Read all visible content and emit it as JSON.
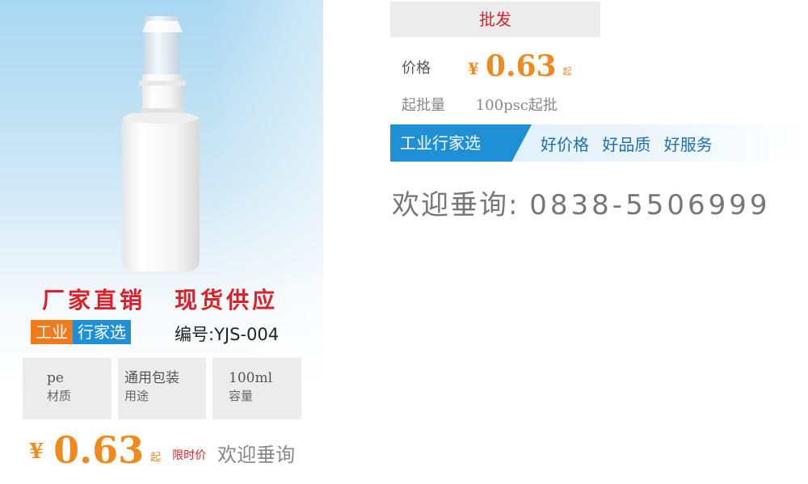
{
  "left": {
    "slogan_a": "厂家直销",
    "slogan_b": "现货供应",
    "brand_a": "工业",
    "brand_b": "行家选",
    "code": "编号:YJS-004",
    "specs": [
      {
        "value": "pe",
        "label": "材质"
      },
      {
        "value": "通用包装",
        "label": "用途"
      },
      {
        "value": "100ml",
        "label": "容量"
      }
    ],
    "price": {
      "currency": "¥",
      "amount": "0.63",
      "unit": "起",
      "limit": "限时价",
      "welcome": "欢迎垂询"
    }
  },
  "right": {
    "header": "批发",
    "price_label": "价格",
    "price_currency": "¥",
    "price_amount": "0.63",
    "price_unit": "起",
    "moq_label": "起批量",
    "moq_value": "100psc起批",
    "banner_tag": "工业行家选",
    "banner_items": [
      "好价格",
      "好品质",
      "好服务"
    ],
    "contact_label": "欢迎垂询:",
    "contact_phone": "0838-5506999"
  },
  "colors": {
    "red": "#d9232a",
    "orange": "#f08a1c",
    "blue": "#1f8fd6"
  },
  "icons": {
    "product": "white-pump-bottle"
  }
}
